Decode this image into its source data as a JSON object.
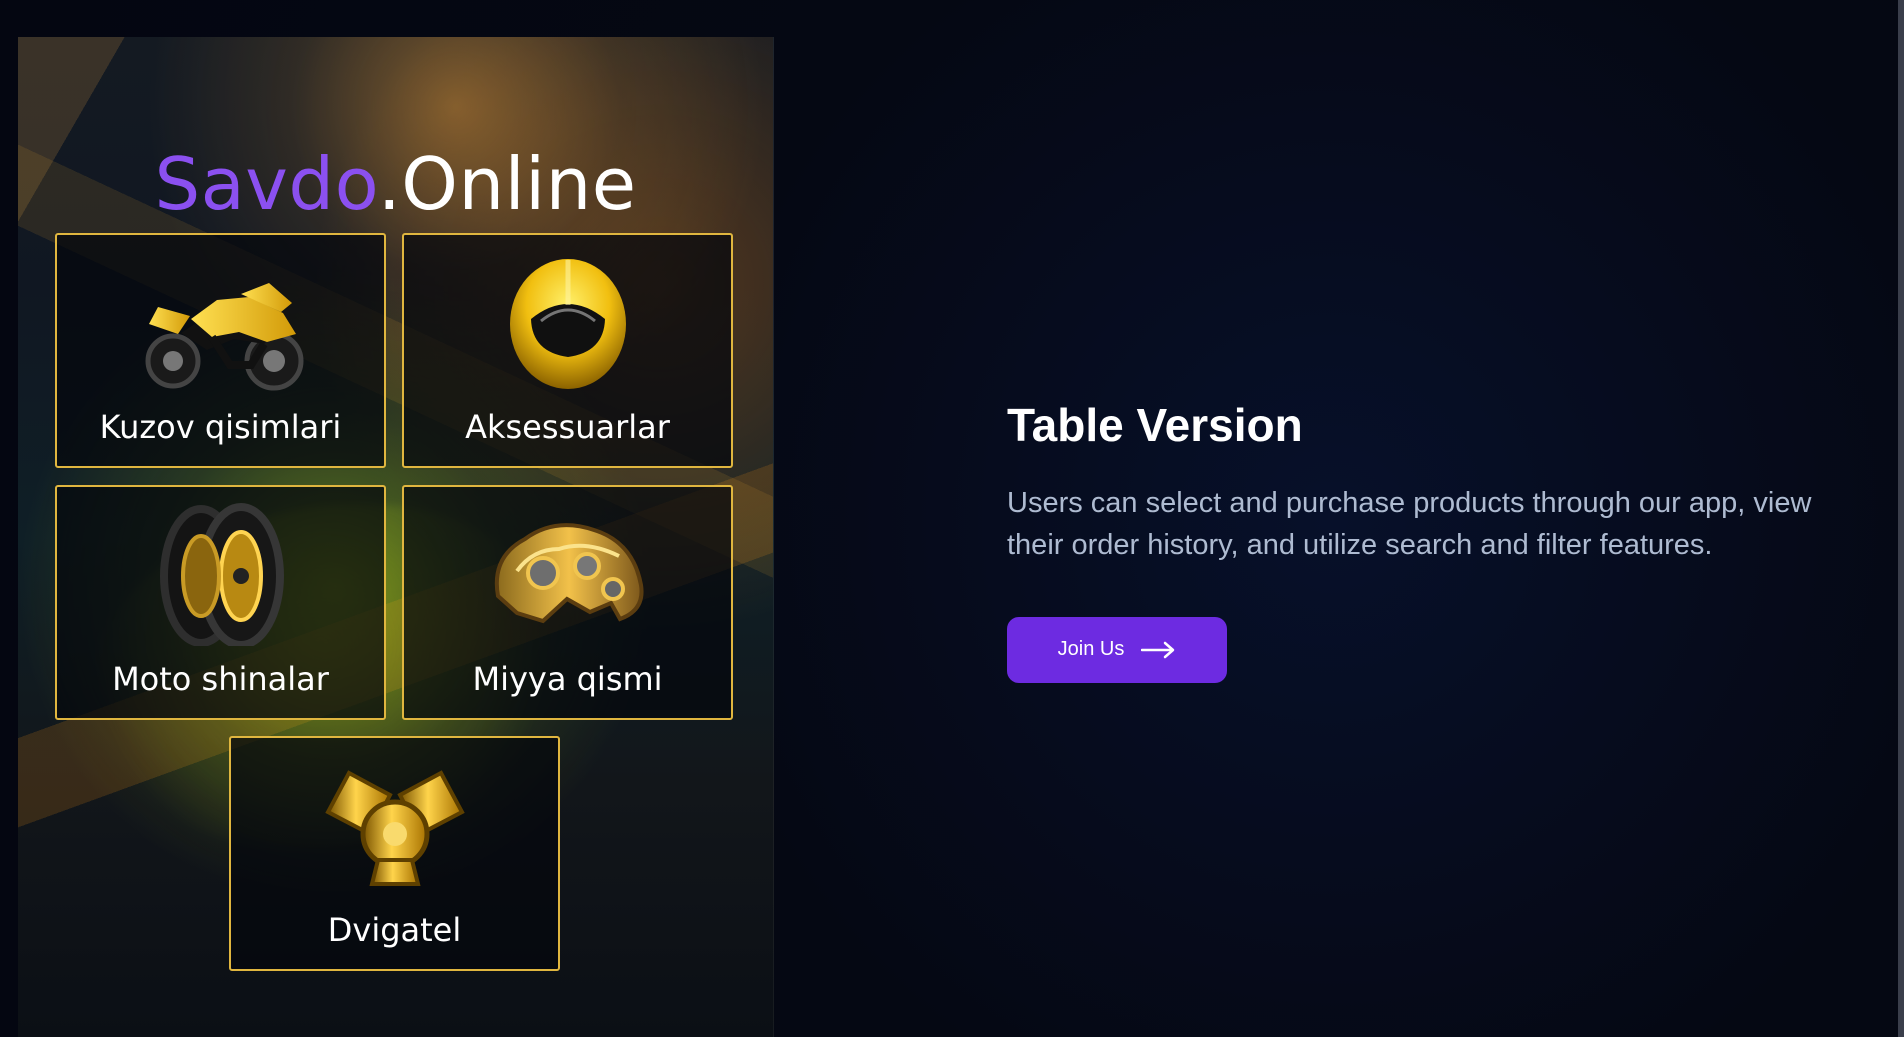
{
  "brand": {
    "accent": "Savdo",
    "rest": ".Online"
  },
  "categories": [
    {
      "label": "Kuzov qisimlari",
      "icon": "motorcycle-icon"
    },
    {
      "label": "Aksessuarlar",
      "icon": "helmet-icon"
    },
    {
      "label": "Moto shinalar",
      "icon": "tires-icon"
    },
    {
      "label": "Miyya qismi",
      "icon": "mechanical-brain-icon"
    },
    {
      "label": "Dvigatel",
      "icon": "engine-icon"
    }
  ],
  "main": {
    "title": "Table Version",
    "description": "Users can select and purchase products through our app, view their order history, and utilize search and filter features.",
    "join_label": "Join Us"
  },
  "colors": {
    "brand_accent": "#8b50f0",
    "card_border": "#e0b63f",
    "button": "#6d2be1",
    "background": "#050813"
  }
}
